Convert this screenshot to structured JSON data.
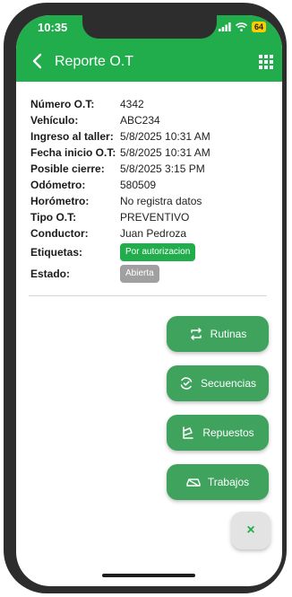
{
  "status": {
    "time": "10:35",
    "battery": "64"
  },
  "appbar": {
    "title": "Reporte O.T"
  },
  "details": [
    {
      "label": "Número O.T:",
      "value": "4342"
    },
    {
      "label": "Vehículo:",
      "value": "ABC234"
    },
    {
      "label": "Ingreso al taller:",
      "value": "5/8/2025 10:31 AM"
    },
    {
      "label": "Fecha inicio O.T:",
      "value": "5/8/2025 10:31 AM"
    },
    {
      "label": "Posible cierre:",
      "value": "5/8/2025 3:15 PM"
    },
    {
      "label": "Odómetro:",
      "value": "580509"
    },
    {
      "label": "Horómetro:",
      "value": "No registra datos"
    },
    {
      "label": "Tipo O.T:",
      "value": "PREVENTIVO"
    },
    {
      "label": "Conductor:",
      "value": "Juan Pedroza"
    }
  ],
  "etiquetas": {
    "label": "Etiquetas:",
    "badge": "Por autorizacion"
  },
  "estado": {
    "label": "Estado:",
    "badge": "Abierta"
  },
  "actions": {
    "rutinas": "Rutinas",
    "secuencias": "Secuencias",
    "repuestos": "Repuestos",
    "trabajos": "Trabajos",
    "close": "×"
  },
  "colors": {
    "primary": "#22ad4d",
    "fab": "#3fa35e",
    "badge_gray": "#a0a0a0"
  }
}
